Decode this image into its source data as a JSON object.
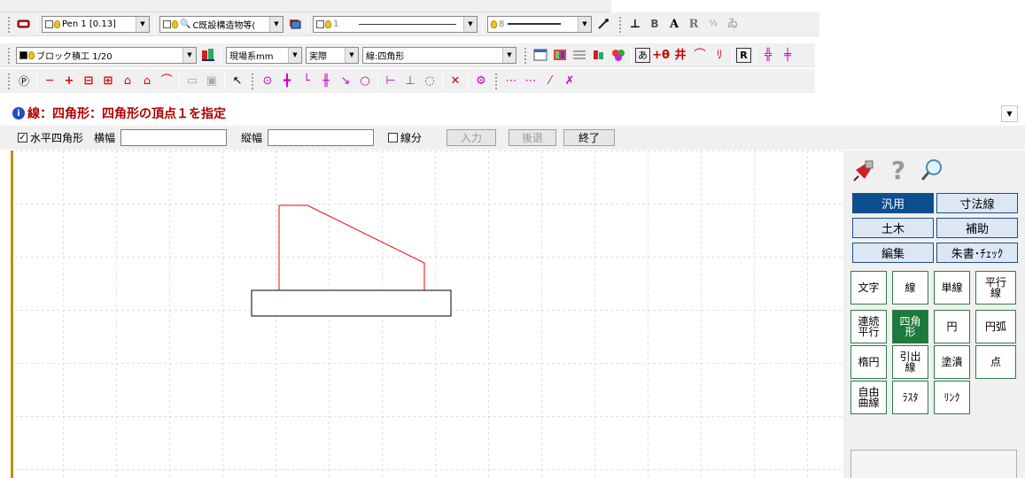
{
  "toolbar1": {
    "pen_combo": "Pen 1 [0.13]",
    "layer_combo": "C既設構造物等(",
    "linetype_combo": "1",
    "linewidth_combo": "8"
  },
  "toolbar2": {
    "style_combo": "ブロック積工 1/20",
    "unit_combo": "現場系mm",
    "scale_combo": "実際",
    "command_combo": "線:四角形"
  },
  "status": {
    "message": "線：四角形：四角形の頂点１を指定"
  },
  "options": {
    "horizontal_rect_label": "水平四角形",
    "horizontal_rect_checked": true,
    "width_label": "横幅",
    "width_value": "",
    "height_label": "縦幅",
    "height_value": "",
    "segment_label": "線分",
    "segment_checked": false,
    "input_button": "入力",
    "back_button": "後退",
    "finish_button": "終了"
  },
  "palette": {
    "categories": [
      "汎用",
      "寸法線",
      "土木",
      "補助",
      "編集",
      "朱書･ﾁｪｯｸ"
    ],
    "active_category": "汎用",
    "commands": [
      "文字",
      "線",
      "単線",
      "平行\n線",
      "連続\n平行",
      "四角\n形",
      "円",
      "円弧",
      "楕円",
      "引出\n線",
      "塗潰",
      "点",
      "自由\n曲線",
      "ﾗｽﾀ",
      "ﾘﾝｸ"
    ],
    "active_command": "四角\n形"
  },
  "icons": {
    "toolbar1": [
      "eraser-icon",
      "pen-color-icon",
      "layer-icon",
      "linetype-icon",
      "linewidth-icon",
      "eyedropper-icon",
      "text-icon",
      "text-size-icon"
    ],
    "toolbar2": [
      "layer-manager-icon",
      "grid-icon",
      "hatch-icon",
      "color-icon"
    ],
    "palette_header": [
      "pushpin-icon",
      "help-icon",
      "zoom-icon"
    ]
  },
  "colors": {
    "active_category": "#0b4f8f",
    "active_command": "#1e7a3c",
    "status_text": "#b00000",
    "drawing_red": "#ff0000",
    "canvas_border": "#c98b1a"
  }
}
